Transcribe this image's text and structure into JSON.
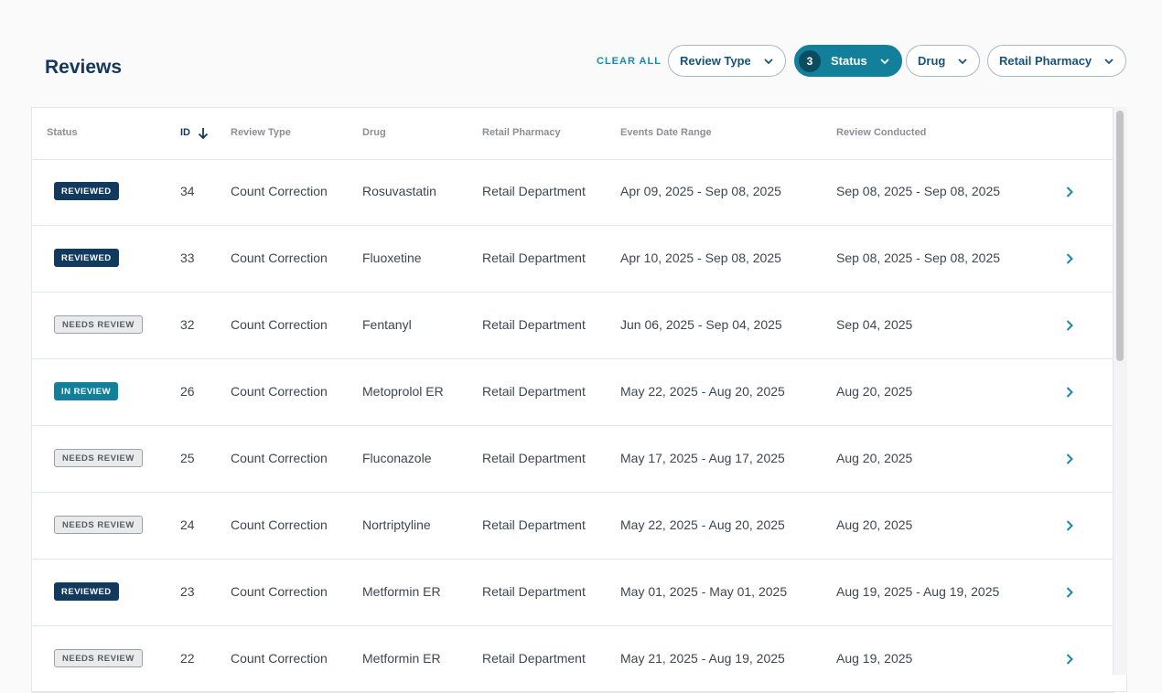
{
  "page": {
    "title": "Reviews"
  },
  "filters": {
    "clear_all": "CLEAR ALL",
    "review_type": "Review Type",
    "status": "Status",
    "status_count": "3",
    "drug": "Drug",
    "retail_pharmacy": "Retail Pharmacy"
  },
  "columns": {
    "status": "Status",
    "id": "ID",
    "review_type": "Review Type",
    "drug": "Drug",
    "retail_pharmacy": "Retail Pharmacy",
    "events_date_range": "Events Date Range",
    "review_conducted": "Review Conducted"
  },
  "rows": [
    {
      "status": "REVIEWED",
      "status_kind": "reviewed",
      "id": "34",
      "review_type": "Count Correction",
      "drug": "Rosuvastatin",
      "pharmacy": "Retail Department",
      "events": "Apr 09, 2025 - Sep 08, 2025",
      "conducted": "Sep 08, 2025 - Sep 08, 2025"
    },
    {
      "status": "REVIEWED",
      "status_kind": "reviewed",
      "id": "33",
      "review_type": "Count Correction",
      "drug": "Fluoxetine",
      "pharmacy": "Retail Department",
      "events": "Apr 10, 2025 - Sep 08, 2025",
      "conducted": "Sep 08, 2025 - Sep 08, 2025"
    },
    {
      "status": "NEEDS REVIEW",
      "status_kind": "needs",
      "id": "32",
      "review_type": "Count Correction",
      "drug": "Fentanyl",
      "pharmacy": "Retail Department",
      "events": "Jun 06, 2025 - Sep 04, 2025",
      "conducted": "Sep 04, 2025"
    },
    {
      "status": "IN REVIEW",
      "status_kind": "in-review",
      "id": "26",
      "review_type": "Count Correction",
      "drug": "Metoprolol ER",
      "pharmacy": "Retail Department",
      "events": "May 22, 2025 - Aug 20, 2025",
      "conducted": "Aug 20, 2025"
    },
    {
      "status": "NEEDS REVIEW",
      "status_kind": "needs",
      "id": "25",
      "review_type": "Count Correction",
      "drug": "Fluconazole",
      "pharmacy": "Retail Department",
      "events": "May 17, 2025 - Aug 17, 2025",
      "conducted": "Aug 20, 2025"
    },
    {
      "status": "NEEDS REVIEW",
      "status_kind": "needs",
      "id": "24",
      "review_type": "Count Correction",
      "drug": "Nortriptyline",
      "pharmacy": "Retail Department",
      "events": "May 22, 2025 - Aug 20, 2025",
      "conducted": "Aug 20, 2025"
    },
    {
      "status": "REVIEWED",
      "status_kind": "reviewed",
      "id": "23",
      "review_type": "Count Correction",
      "drug": "Metformin ER",
      "pharmacy": "Retail Department",
      "events": "May 01, 2025 - May 01, 2025",
      "conducted": "Aug 19, 2025 - Aug 19, 2025"
    },
    {
      "status": "NEEDS REVIEW",
      "status_kind": "needs",
      "id": "22",
      "review_type": "Count Correction",
      "drug": "Metformin ER",
      "pharmacy": "Retail Department",
      "events": "May 21, 2025 - Aug 19, 2025",
      "conducted": "Aug 19, 2025"
    }
  ]
}
